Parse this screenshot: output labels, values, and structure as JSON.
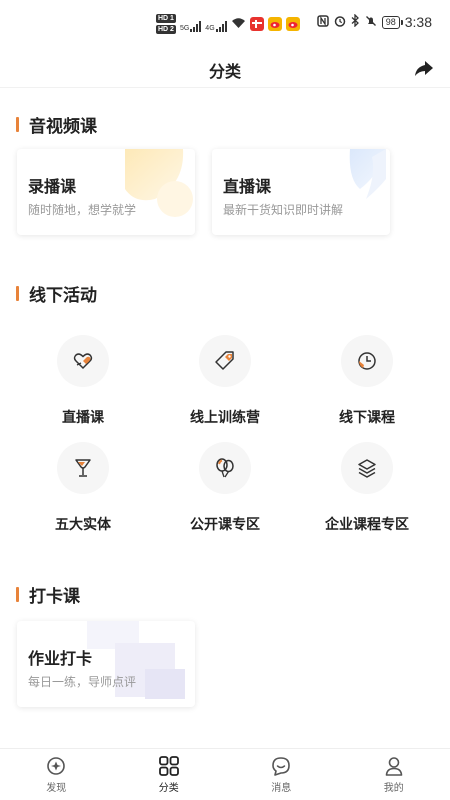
{
  "status_bar": {
    "hd1": "HD 1",
    "hd2": "HD 2",
    "net1": "5G",
    "net2": "4G",
    "battery": "98",
    "time": "3:38"
  },
  "header": {
    "title": "分类"
  },
  "sections": {
    "av": {
      "title": "音视频课",
      "cards": [
        {
          "title": "录播课",
          "subtitle": "随时随地，想学就学"
        },
        {
          "title": "直播课",
          "subtitle": "最新干货知识即时讲解"
        }
      ]
    },
    "offline": {
      "title": "线下活动",
      "items": [
        {
          "label": "直播课",
          "icon": "heart-hand-icon"
        },
        {
          "label": "线上训练营",
          "icon": "tag-icon"
        },
        {
          "label": "线下课程",
          "icon": "clock-icon"
        },
        {
          "label": "五大实体",
          "icon": "glass-icon"
        },
        {
          "label": "公开课专区",
          "icon": "balloons-icon"
        },
        {
          "label": "企业课程专区",
          "icon": "layers-icon"
        }
      ]
    },
    "checkin": {
      "title": "打卡课",
      "cards": [
        {
          "title": "作业打卡",
          "subtitle": "每日一练，导师点评"
        }
      ]
    }
  },
  "bottom_nav": [
    {
      "label": "发现",
      "icon": "discover-icon",
      "active": false
    },
    {
      "label": "分类",
      "icon": "grid-icon",
      "active": true
    },
    {
      "label": "消息",
      "icon": "message-icon",
      "active": false
    },
    {
      "label": "我的",
      "icon": "profile-icon",
      "active": false
    }
  ],
  "colors": {
    "accent": "#e8833a",
    "accent_light": "#f6c9a4"
  }
}
